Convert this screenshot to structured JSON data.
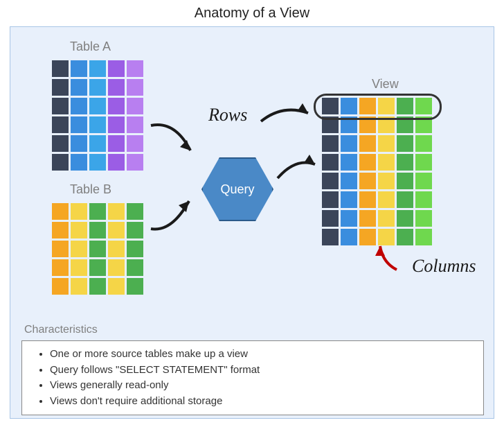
{
  "title": "Anatomy of a View",
  "labels": {
    "tableA": "Table A",
    "tableB": "Table B",
    "view": "View",
    "query": "Query",
    "rows": "Rows",
    "columns": "Columns",
    "characteristics": "Characteristics"
  },
  "tableA": {
    "rows": 6,
    "cols": 5,
    "colColors": [
      "darkblue",
      "blue",
      "cyan",
      "purple",
      "violet"
    ]
  },
  "tableB": {
    "rows": 5,
    "cols": 5,
    "colColors": [
      "orange",
      "yellow",
      "green",
      "yellow",
      "green"
    ]
  },
  "viewGrid": {
    "rows": 8,
    "cols": 6,
    "colColors": [
      "darkblue",
      "blue",
      "orange",
      "yellow",
      "green",
      "lime"
    ]
  },
  "characteristics": [
    "One or more source tables make up a view",
    "Query follows \"SELECT STATEMENT\" format",
    "Views generally read-only",
    "Views don't require additional storage"
  ]
}
